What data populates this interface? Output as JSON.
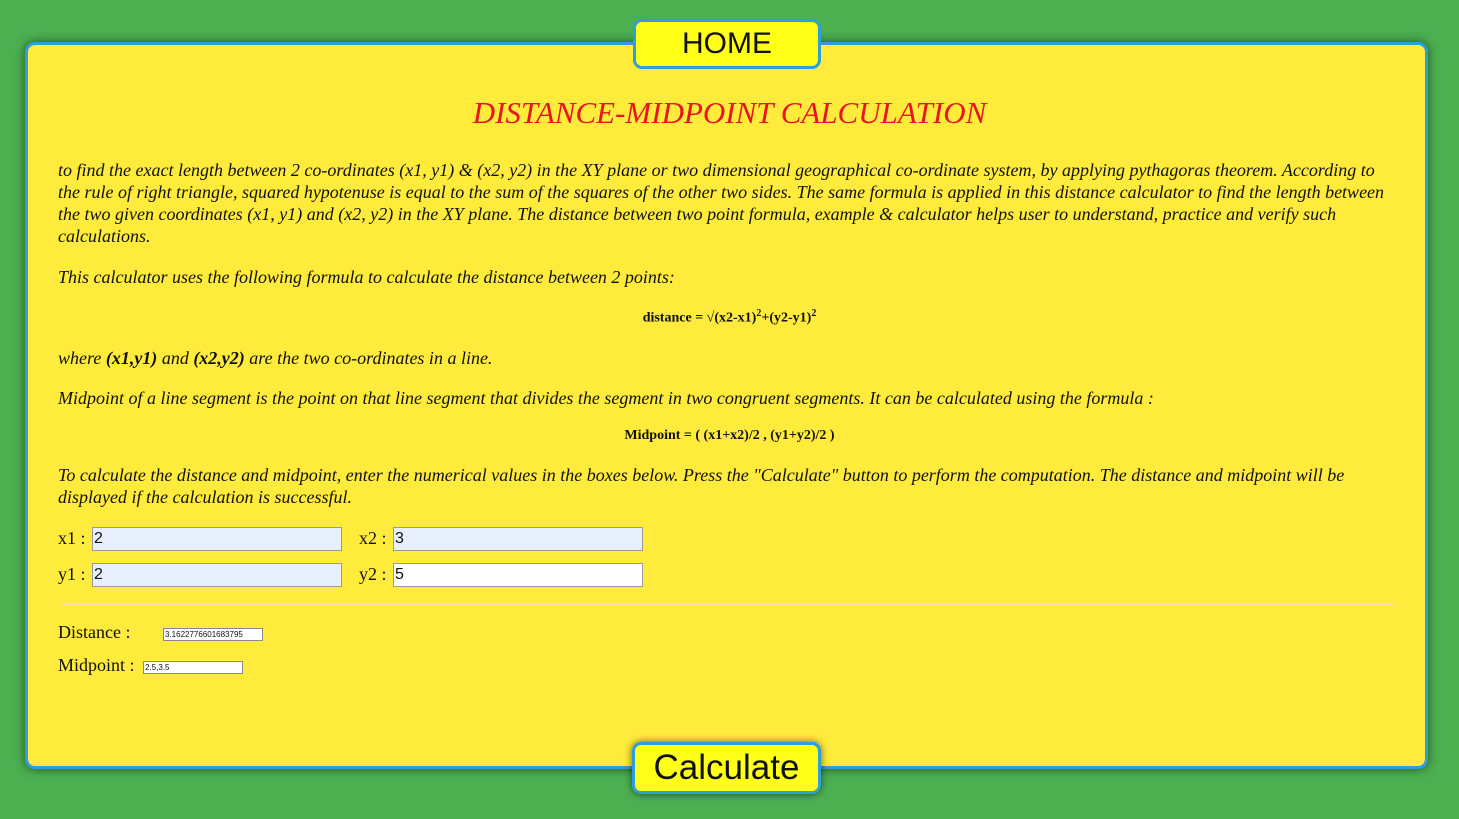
{
  "nav": {
    "home_label": "HOME"
  },
  "title": "DISTANCE-MIDPOINT CALCULATION",
  "intro_text": "to find the exact length between 2 co-ordinates (x1, y1) & (x2, y2) in the XY plane or two dimensional geographical co-ordinate system, by applying pythagoras theorem. According to the rule of right triangle, squared hypotenuse is equal to the sum of the squares of the other two sides. The same formula is applied in this distance calculator to find the length between the two given coordinates (x1, y1) and (x2, y2) in the XY plane. The distance between two point formula, example & calculator helps user to understand, practice and verify such calculations.",
  "formula_intro": "This calculator uses the following formula to calculate the distance between 2 points:",
  "distance_formula": {
    "prefix": "distance = √(x2-x1)",
    "sup1": "2",
    "middle": "+(y2-y1)",
    "sup2": "2"
  },
  "where_text": {
    "pre": "where ",
    "p1": "(x1,y1)",
    "mid": " and ",
    "p2": "(x2,y2)",
    "post": " are the two co-ordinates in a line."
  },
  "midpoint_text": "Midpoint of a line segment is the point on that line segment that divides the segment in two congruent segments. It can be calculated using the formula :",
  "midpoint_formula": "Midpoint = ( (x1+x2)/2 , (y1+y2)/2 )",
  "instructions": "To calculate the distance and midpoint, enter the numerical values in the boxes below. Press the \"Calculate\" button to perform the computation. The distance and midpoint will be displayed if the calculation is successful.",
  "inputs": {
    "x1": {
      "label": "x1 :",
      "value": "2"
    },
    "x2": {
      "label": "x2 :",
      "value": "3"
    },
    "y1": {
      "label": "y1 :",
      "value": "2"
    },
    "y2": {
      "label": "y2 :",
      "value": "5"
    }
  },
  "results": {
    "distance_label": "Distance :",
    "distance_value": "3.1622776601683795",
    "midpoint_label": "Midpoint :",
    "midpoint_value": "2.5,3.5"
  },
  "calculate_label": "Calculate",
  "colors": {
    "background": "#4caf50",
    "panel": "#ffeb3b",
    "button": "#ffff18",
    "border": "#2e9fd8",
    "title": "#e8141e"
  }
}
